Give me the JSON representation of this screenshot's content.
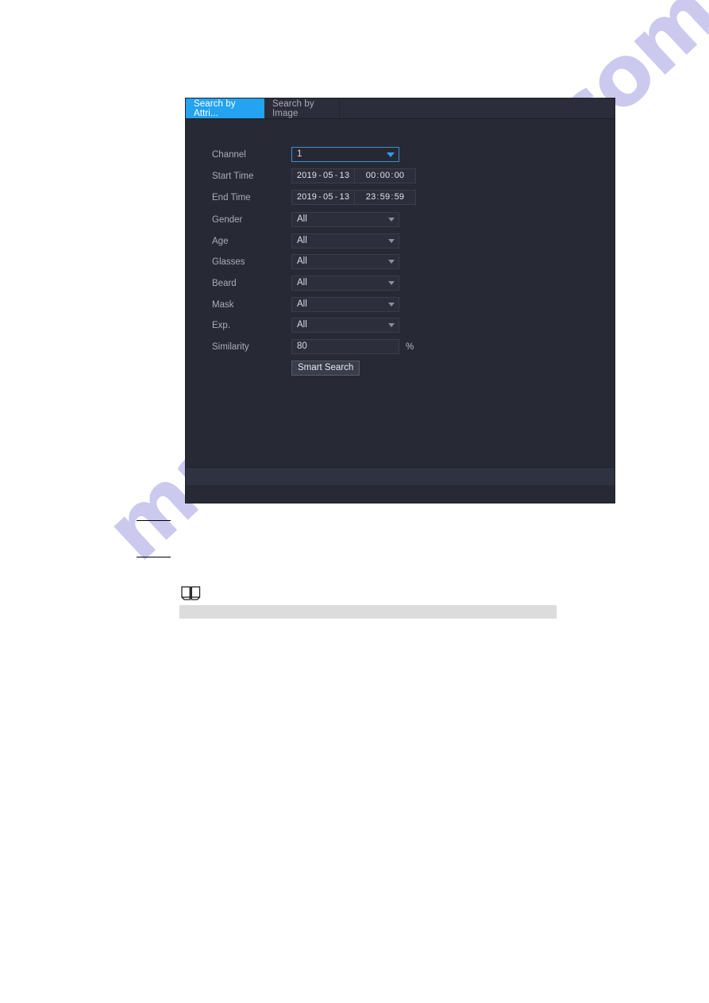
{
  "watermark": {
    "text": "manualshive.com"
  },
  "dialog": {
    "tabs": [
      {
        "id": "search-by-attribute",
        "label": "Search by Attri...",
        "active": true
      },
      {
        "id": "search-by-image",
        "label": "Search by Image",
        "active": false
      }
    ],
    "accent_color": "#23a3f0",
    "background_color": "#272a35",
    "fields": {
      "channel": {
        "label": "Channel",
        "value": "1",
        "type": "select",
        "focused": true
      },
      "start_time": {
        "label": "Start Time",
        "date": {
          "year": "2019",
          "month": "05",
          "day": "13"
        },
        "time": {
          "hour": "00",
          "minute": "00",
          "second": "00"
        }
      },
      "end_time": {
        "label": "End Time",
        "date": {
          "year": "2019",
          "month": "05",
          "day": "13"
        },
        "time": {
          "hour": "23",
          "minute": "59",
          "second": "59"
        }
      },
      "gender": {
        "label": "Gender",
        "value": "All",
        "type": "select"
      },
      "age": {
        "label": "Age",
        "value": "All",
        "type": "select"
      },
      "glasses": {
        "label": "Glasses",
        "value": "All",
        "type": "select"
      },
      "beard": {
        "label": "Beard",
        "value": "All",
        "type": "select"
      },
      "mask": {
        "label": "Mask",
        "value": "All",
        "type": "select"
      },
      "exp": {
        "label": "Exp.",
        "value": "All",
        "type": "select"
      },
      "similarity": {
        "label": "Similarity",
        "value": "80",
        "unit": "%",
        "type": "text"
      }
    },
    "buttons": {
      "smart_search": "Smart Search"
    }
  },
  "note": {
    "icon": "open-book-icon"
  },
  "date_separator": "-",
  "time_separator": ":"
}
